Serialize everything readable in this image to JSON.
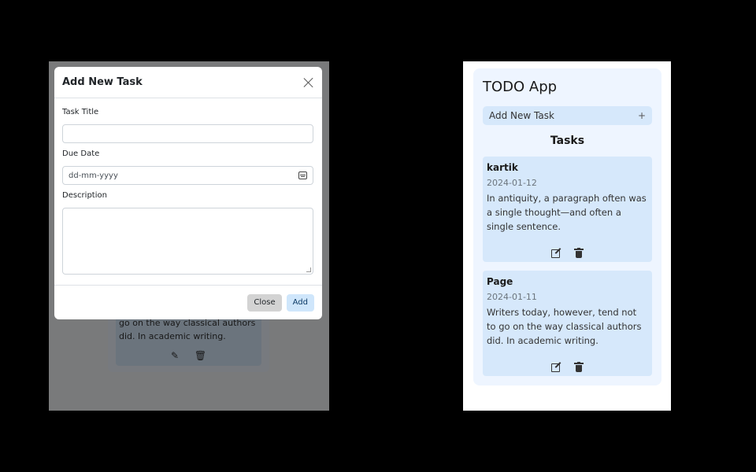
{
  "modal": {
    "title": "Add New Task",
    "task_title_label": "Task Title",
    "task_title_value": "",
    "due_date_label": "Due Date",
    "due_date_placeholder": "dd-mm-yyyy",
    "description_label": "Description",
    "description_value": "",
    "close_label": "Close",
    "add_label": "Add"
  },
  "background_app": {
    "partial_card_description": "go on the way classical authors did. In academic writing."
  },
  "app": {
    "title": "TODO App",
    "add_task_label": "Add New Task",
    "add_task_symbol": "+",
    "tasks_heading": "Tasks",
    "tasks": [
      {
        "name": "kartik",
        "date": "2024-01-12",
        "description": "In antiquity, a paragraph often was a single thought—and often a single sentence."
      },
      {
        "name": "Page",
        "date": "2024-01-11",
        "description": "Writers today, however, tend not to go on the way classical authors did. In academic writing."
      }
    ]
  },
  "icons": {
    "close": "close-icon",
    "calendar": "calendar-icon",
    "edit": "edit-icon",
    "delete": "trash-icon"
  }
}
